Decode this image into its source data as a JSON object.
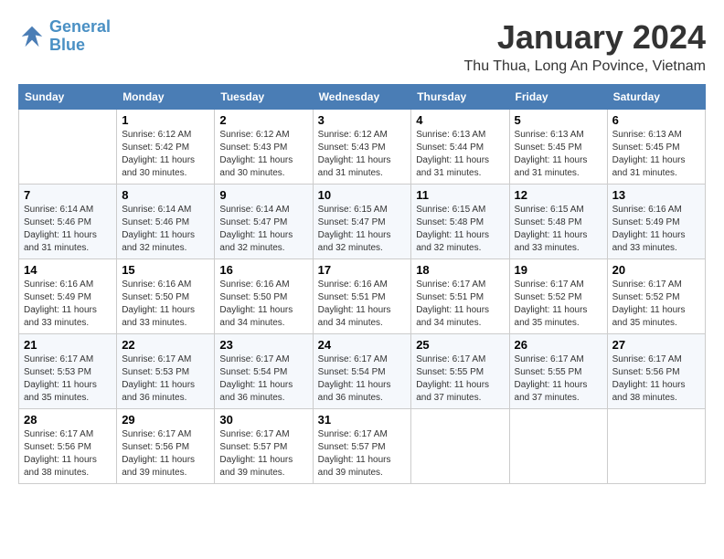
{
  "logo": {
    "line1": "General",
    "line2": "Blue"
  },
  "calendar": {
    "title": "January 2024",
    "subtitle": "Thu Thua, Long An Povince, Vietnam"
  },
  "headers": [
    "Sunday",
    "Monday",
    "Tuesday",
    "Wednesday",
    "Thursday",
    "Friday",
    "Saturday"
  ],
  "weeks": [
    [
      {
        "day": "",
        "info": ""
      },
      {
        "day": "1",
        "info": "Sunrise: 6:12 AM\nSunset: 5:42 PM\nDaylight: 11 hours\nand 30 minutes."
      },
      {
        "day": "2",
        "info": "Sunrise: 6:12 AM\nSunset: 5:43 PM\nDaylight: 11 hours\nand 30 minutes."
      },
      {
        "day": "3",
        "info": "Sunrise: 6:12 AM\nSunset: 5:43 PM\nDaylight: 11 hours\nand 31 minutes."
      },
      {
        "day": "4",
        "info": "Sunrise: 6:13 AM\nSunset: 5:44 PM\nDaylight: 11 hours\nand 31 minutes."
      },
      {
        "day": "5",
        "info": "Sunrise: 6:13 AM\nSunset: 5:45 PM\nDaylight: 11 hours\nand 31 minutes."
      },
      {
        "day": "6",
        "info": "Sunrise: 6:13 AM\nSunset: 5:45 PM\nDaylight: 11 hours\nand 31 minutes."
      }
    ],
    [
      {
        "day": "7",
        "info": "Sunrise: 6:14 AM\nSunset: 5:46 PM\nDaylight: 11 hours\nand 31 minutes."
      },
      {
        "day": "8",
        "info": "Sunrise: 6:14 AM\nSunset: 5:46 PM\nDaylight: 11 hours\nand 32 minutes."
      },
      {
        "day": "9",
        "info": "Sunrise: 6:14 AM\nSunset: 5:47 PM\nDaylight: 11 hours\nand 32 minutes."
      },
      {
        "day": "10",
        "info": "Sunrise: 6:15 AM\nSunset: 5:47 PM\nDaylight: 11 hours\nand 32 minutes."
      },
      {
        "day": "11",
        "info": "Sunrise: 6:15 AM\nSunset: 5:48 PM\nDaylight: 11 hours\nand 32 minutes."
      },
      {
        "day": "12",
        "info": "Sunrise: 6:15 AM\nSunset: 5:48 PM\nDaylight: 11 hours\nand 33 minutes."
      },
      {
        "day": "13",
        "info": "Sunrise: 6:16 AM\nSunset: 5:49 PM\nDaylight: 11 hours\nand 33 minutes."
      }
    ],
    [
      {
        "day": "14",
        "info": "Sunrise: 6:16 AM\nSunset: 5:49 PM\nDaylight: 11 hours\nand 33 minutes."
      },
      {
        "day": "15",
        "info": "Sunrise: 6:16 AM\nSunset: 5:50 PM\nDaylight: 11 hours\nand 33 minutes."
      },
      {
        "day": "16",
        "info": "Sunrise: 6:16 AM\nSunset: 5:50 PM\nDaylight: 11 hours\nand 34 minutes."
      },
      {
        "day": "17",
        "info": "Sunrise: 6:16 AM\nSunset: 5:51 PM\nDaylight: 11 hours\nand 34 minutes."
      },
      {
        "day": "18",
        "info": "Sunrise: 6:17 AM\nSunset: 5:51 PM\nDaylight: 11 hours\nand 34 minutes."
      },
      {
        "day": "19",
        "info": "Sunrise: 6:17 AM\nSunset: 5:52 PM\nDaylight: 11 hours\nand 35 minutes."
      },
      {
        "day": "20",
        "info": "Sunrise: 6:17 AM\nSunset: 5:52 PM\nDaylight: 11 hours\nand 35 minutes."
      }
    ],
    [
      {
        "day": "21",
        "info": "Sunrise: 6:17 AM\nSunset: 5:53 PM\nDaylight: 11 hours\nand 35 minutes."
      },
      {
        "day": "22",
        "info": "Sunrise: 6:17 AM\nSunset: 5:53 PM\nDaylight: 11 hours\nand 36 minutes."
      },
      {
        "day": "23",
        "info": "Sunrise: 6:17 AM\nSunset: 5:54 PM\nDaylight: 11 hours\nand 36 minutes."
      },
      {
        "day": "24",
        "info": "Sunrise: 6:17 AM\nSunset: 5:54 PM\nDaylight: 11 hours\nand 36 minutes."
      },
      {
        "day": "25",
        "info": "Sunrise: 6:17 AM\nSunset: 5:55 PM\nDaylight: 11 hours\nand 37 minutes."
      },
      {
        "day": "26",
        "info": "Sunrise: 6:17 AM\nSunset: 5:55 PM\nDaylight: 11 hours\nand 37 minutes."
      },
      {
        "day": "27",
        "info": "Sunrise: 6:17 AM\nSunset: 5:56 PM\nDaylight: 11 hours\nand 38 minutes."
      }
    ],
    [
      {
        "day": "28",
        "info": "Sunrise: 6:17 AM\nSunset: 5:56 PM\nDaylight: 11 hours\nand 38 minutes."
      },
      {
        "day": "29",
        "info": "Sunrise: 6:17 AM\nSunset: 5:56 PM\nDaylight: 11 hours\nand 39 minutes."
      },
      {
        "day": "30",
        "info": "Sunrise: 6:17 AM\nSunset: 5:57 PM\nDaylight: 11 hours\nand 39 minutes."
      },
      {
        "day": "31",
        "info": "Sunrise: 6:17 AM\nSunset: 5:57 PM\nDaylight: 11 hours\nand 39 minutes."
      },
      {
        "day": "",
        "info": ""
      },
      {
        "day": "",
        "info": ""
      },
      {
        "day": "",
        "info": ""
      }
    ]
  ]
}
